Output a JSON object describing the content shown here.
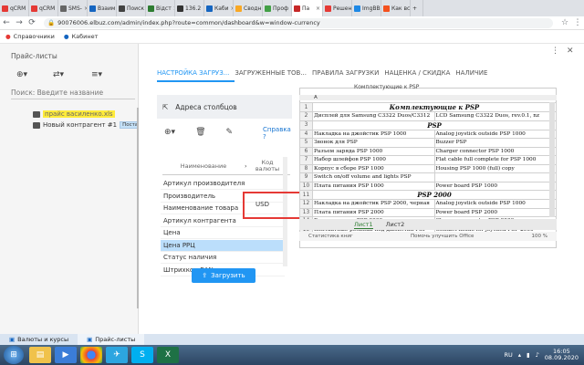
{
  "browser": {
    "tabs": [
      {
        "label": "qCRM",
        "color": "#e53935"
      },
      {
        "label": "qCRM",
        "color": "#e53935"
      },
      {
        "label": "SMS-",
        "color": "#666666"
      },
      {
        "label": "Взаим",
        "color": "#1565c0"
      },
      {
        "label": "Поиск",
        "color": "#424242"
      },
      {
        "label": "Відст",
        "color": "#2e7d32"
      },
      {
        "label": "136.2",
        "color": "#333333"
      },
      {
        "label": "Каби",
        "color": "#1565c0"
      },
      {
        "label": "Сводн",
        "color": "#f9a825"
      },
      {
        "label": "Проф",
        "color": "#43a047"
      },
      {
        "label": "Па",
        "color": "#c62828",
        "active": true
      },
      {
        "label": "Решен",
        "color": "#e53935"
      },
      {
        "label": "ImgBB",
        "color": "#1e88e5"
      },
      {
        "label": "Как вс",
        "color": "#f4511e"
      }
    ],
    "url": "90076006.elbuz.com/admin/index.php?route=common/dashboard&w=window-currency",
    "bookmarks": [
      {
        "label": "Справочники"
      },
      {
        "label": "Кабинет"
      }
    ]
  },
  "sidebar": {
    "title": "Прайс-листы",
    "search_placeholder": "Поиск: Введите название",
    "tree": [
      {
        "label": "прайс василенко.xls"
      },
      {
        "label": "Новый контрагент #1",
        "badge": "Поставщик"
      }
    ]
  },
  "main": {
    "tabs": [
      {
        "label": "НАСТРОЙКА ЗАГРУЗ...",
        "active": true
      },
      {
        "label": "ЗАГРУЖЕННЫЕ ТОВ..."
      },
      {
        "label": "ПРАВИЛА ЗАГРУЗКИ"
      },
      {
        "label": "НАЦЕНКА / СКИДКА"
      },
      {
        "label": "НАЛИЧИЕ"
      }
    ],
    "columns_header": "Адреса столбцов",
    "help_label": "Справка",
    "help_mark": "?",
    "col_name_header": "Наименование",
    "col_code_header": "Код валюты",
    "rows": [
      {
        "label": "Артикул производителя"
      },
      {
        "label": "Производитель"
      },
      {
        "label": "Наименование товара"
      },
      {
        "label": "Артикул контрагента"
      },
      {
        "label": "Цена"
      },
      {
        "label": "Цена РРЦ",
        "selected": true
      },
      {
        "label": "Статус наличия"
      },
      {
        "label": "Штрихкод EAN"
      }
    ],
    "currency_value": "USD",
    "load_button": "Загрузить"
  },
  "excel": {
    "cell_ref": "Комплектующие к PSP",
    "col_letters": [
      "A",
      "B",
      "C",
      "D"
    ],
    "rows": [
      {
        "n": "1",
        "b": "",
        "c": "Комплектующие к PSP",
        "title": true
      },
      {
        "n": "2",
        "b": "Дисплей для Samsung C3322 Duos/C3312",
        "c": "LCD Samsung C3322 Duos, rev.0.1, nz"
      },
      {
        "n": "3",
        "b": "",
        "c": "PSP",
        "title": true
      },
      {
        "n": "4",
        "b": "Накладка на джойстик PSP 1000",
        "c": "Analog joystick outside PSP 1000"
      },
      {
        "n": "5",
        "b": "Звонок для PSP",
        "c": "Buzzer PSP"
      },
      {
        "n": "6",
        "b": "Разъем заряда PSP 1000",
        "c": "Charger connector PSP 1000"
      },
      {
        "n": "7",
        "b": "Набор шлейфов PSP 1000",
        "c": "Flat cable full complete for PSP 1000"
      },
      {
        "n": "8",
        "b": "Корпус в сборе PSP 1000",
        "c": "Housing PSP 1000 (full) copy"
      },
      {
        "n": "9",
        "b": "Switch on/off volume and lights PSP",
        "c": ""
      },
      {
        "n": "10",
        "b": "Плата питания PSP 1000",
        "c": "Power board PSP 1000"
      },
      {
        "n": "11",
        "b": "",
        "c": "PSP 2000",
        "title": true
      },
      {
        "n": "12",
        "b": "Накладка на джойстик PSP 2000, черная",
        "c": "Analog joystick outside PSP 1000"
      },
      {
        "n": "13",
        "b": "Плата питания PSP 2000",
        "c": "Power board PSP 2000"
      },
      {
        "n": "14",
        "b": "Разъем заряда PSP 2000",
        "c": "Charger connector PSP 2000"
      },
      {
        "n": "15",
        "b": "Контактные резинки под джойстик PSP",
        "c": "Contact inside for joystick PSP 2000"
      }
    ],
    "sheets": [
      {
        "label": "Лист1",
        "active": true
      },
      {
        "label": "Лист2"
      }
    ],
    "status_left": "Статистика книг",
    "status_mid": "Помочь улучшить Office",
    "zoom": "100 %"
  },
  "windows_strip": [
    {
      "label": "Валюты и курсы"
    },
    {
      "label": "Прайс-листы",
      "active": true
    }
  ],
  "taskbar": {
    "lang": "RU",
    "time": "16:05",
    "date": "08.09.2020"
  }
}
